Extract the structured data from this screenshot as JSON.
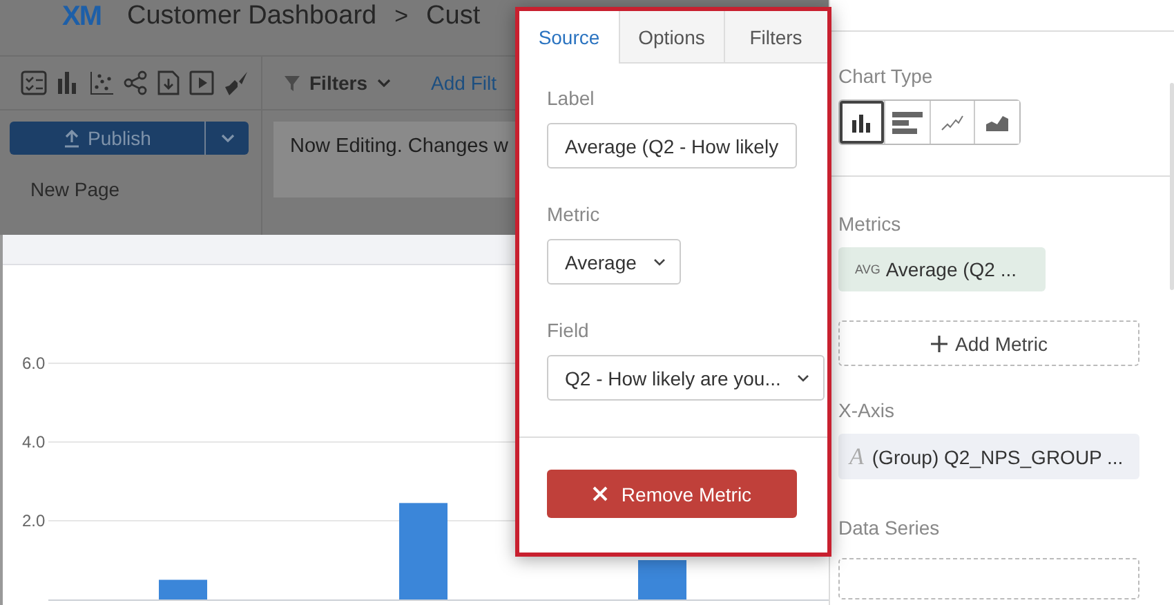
{
  "header": {
    "logo": "XM",
    "breadcrumbs": [
      "Customer Dashboard",
      "Cust"
    ],
    "separator": ">"
  },
  "publish_button": {
    "label": "Publish"
  },
  "pages": [
    {
      "label": "New Page"
    }
  ],
  "filters": {
    "label": "Filters",
    "add_link": "Add Filt"
  },
  "notice": "Now Editing. Changes w",
  "widget": {
    "chart_data": {
      "type": "bar",
      "values": [
        0.5,
        2.45,
        1.0
      ],
      "grid": true,
      "ylim": [
        0,
        6
      ],
      "yticks": [
        {
          "value": 2,
          "label": "2.0"
        },
        {
          "value": 4,
          "label": "4.0"
        },
        {
          "value": 6,
          "label": "6.0"
        }
      ]
    }
  },
  "popup": {
    "tabs": [
      {
        "label": "Source",
        "selected": true
      },
      {
        "label": "Options",
        "selected": false
      },
      {
        "label": "Filters",
        "selected": false
      }
    ],
    "fields": [
      {
        "kind": "input",
        "label": "Label",
        "value": "Average (Q2 - How likely"
      },
      {
        "kind": "select",
        "label": "Metric",
        "value": "Average"
      },
      {
        "kind": "select",
        "label": "Field",
        "value": "Q2 - How likely are you..."
      }
    ],
    "remove_button": "Remove Metric"
  },
  "panel": {
    "chart_type": {
      "label": "Chart Type",
      "options": [
        {
          "kind": "column",
          "selected": true
        },
        {
          "kind": "bar",
          "selected": false
        },
        {
          "kind": "line",
          "selected": false
        },
        {
          "kind": "area",
          "selected": false
        }
      ]
    },
    "metrics": {
      "label": "Metrics",
      "items": [
        {
          "tag": "AVG",
          "label": "Average (Q2 ..."
        }
      ],
      "add_label": "Add Metric"
    },
    "x_axis": {
      "label": "X-Axis",
      "type_icon": "A",
      "value": "(Group) Q2_NPS_GROUP ..."
    },
    "data_series": {
      "label": "Data Series"
    }
  }
}
